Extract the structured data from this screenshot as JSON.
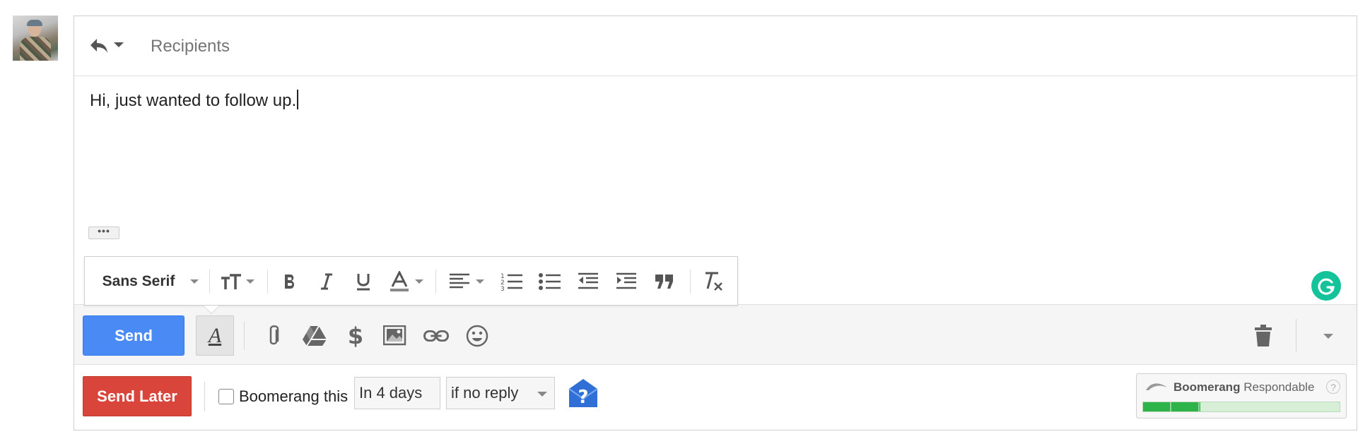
{
  "compose": {
    "recipients_placeholder": "Recipients",
    "body_text": "Hi, just wanted to follow up.",
    "show_trimmed": "•••"
  },
  "formatting": {
    "font": "Sans Serif",
    "icons": [
      "text-size-icon",
      "bold-icon",
      "italic-icon",
      "underline-icon",
      "text-color-icon",
      "align-icon",
      "numbered-list-icon",
      "bulleted-list-icon",
      "indent-less-icon",
      "indent-more-icon",
      "quote-icon",
      "remove-formatting-icon"
    ]
  },
  "actions": {
    "send_label": "Send",
    "formatting_toggle_glyph": "A"
  },
  "boomerang": {
    "send_later_label": "Send Later",
    "checkbox_label": "Boomerang this",
    "checked": false,
    "delay_value": "In 4 days",
    "condition_value": "if no reply",
    "respondable_brand": "Boomerang",
    "respondable_label": "Respondable",
    "respondable_help": "?",
    "respondable_score": 0.29
  },
  "colors": {
    "send_blue": "#4a8af4",
    "send_later_red": "#d9443b",
    "grammarly_green": "#15c39a",
    "respondable_green": "#2db34a"
  }
}
